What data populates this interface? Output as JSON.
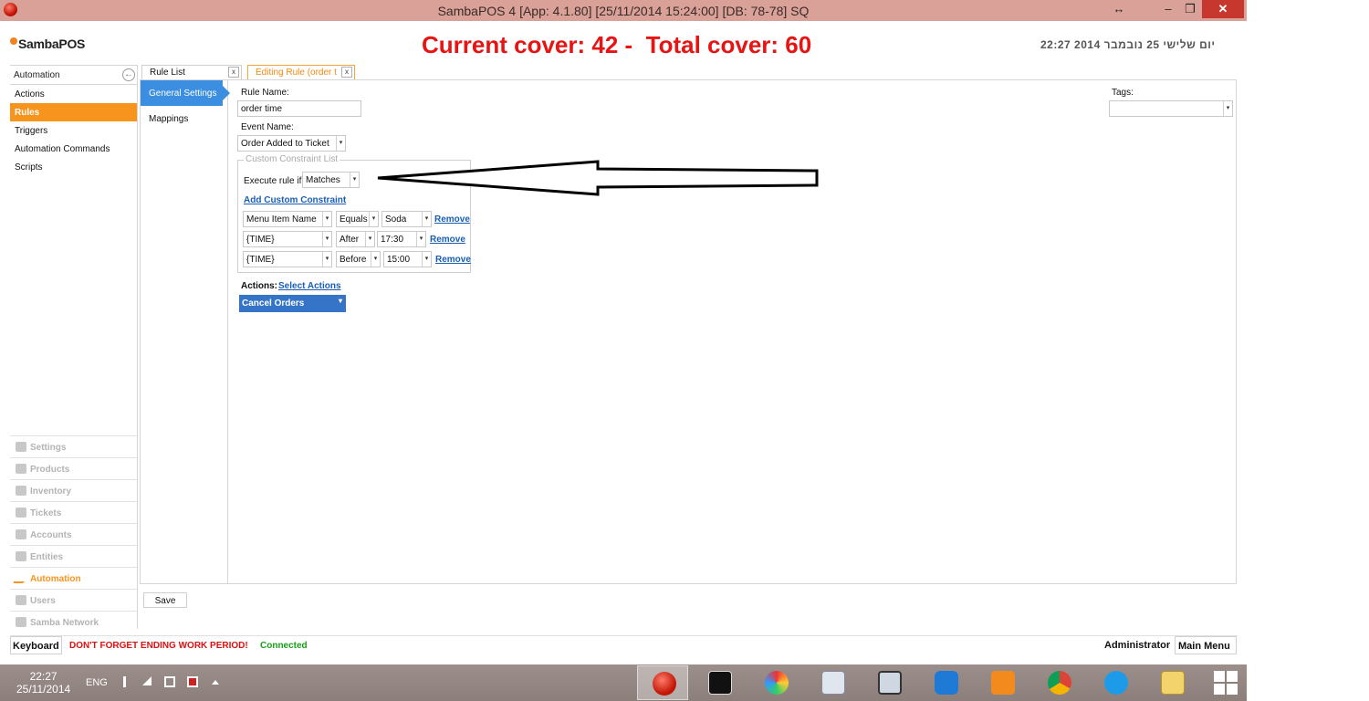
{
  "window": {
    "title": "SambaPOS 4 [App: 4.1.80] [25/11/2014 15:24:00] [DB: 78-78] SQ",
    "resize_glyph": "↔",
    "min_glyph": "–",
    "max_glyph": "❐",
    "close_glyph": "✕"
  },
  "header": {
    "logo": "SambaPOS",
    "cover_text": "Current cover: 42 -  Total cover: 60",
    "datetime": "יום שלישי 25 נובמבר 2014 22:27"
  },
  "leftnav": {
    "title": "Automation",
    "back_glyph": "←",
    "items": [
      {
        "label": "Actions",
        "active": false
      },
      {
        "label": "Rules",
        "active": true
      },
      {
        "label": "Triggers",
        "active": false
      },
      {
        "label": "Automation Commands",
        "active": false
      },
      {
        "label": "Scripts",
        "active": false
      }
    ],
    "sections": [
      {
        "label": "Settings",
        "icon": "gear-icon",
        "active": false
      },
      {
        "label": "Products",
        "icon": "cup-icon",
        "active": false
      },
      {
        "label": "Inventory",
        "icon": "inventory-icon",
        "active": false
      },
      {
        "label": "Tickets",
        "icon": "tickets-icon",
        "active": false
      },
      {
        "label": "Accounts",
        "icon": "calculator-icon",
        "active": false
      },
      {
        "label": "Entities",
        "icon": "entities-icon",
        "active": false
      },
      {
        "label": "Automation",
        "icon": "pencil-icon",
        "active": true
      },
      {
        "label": "Users",
        "icon": "user-icon",
        "active": false
      },
      {
        "label": "Samba Network",
        "icon": "globe-icon",
        "active": false
      }
    ]
  },
  "tabs": [
    {
      "label": "Rule List",
      "close": "x"
    },
    {
      "label": "Editing Rule (order t",
      "close": "x"
    }
  ],
  "subnav": [
    {
      "label": "General Settings",
      "active": true
    },
    {
      "label": "Mappings",
      "active": false
    }
  ],
  "form": {
    "rule_name_label": "Rule Name:",
    "rule_name_value": "order time",
    "event_name_label": "Event Name:",
    "event_name_value": "Order Added to Ticket",
    "tags_label": "Tags:",
    "tags_value": "",
    "constraint_legend": "Custom Constraint List",
    "execute_label": "Execute rule if",
    "execute_value": "Matches",
    "add_constraint_link": "Add Custom Constraint",
    "constraints": [
      {
        "name": "Menu Item Name",
        "op": "Equals",
        "value": "Soda",
        "remove": "Remove"
      },
      {
        "name": "{TIME}",
        "op": "After",
        "value": "17:30",
        "remove": "Remove"
      },
      {
        "name": "{TIME}",
        "op": "Before",
        "value": "15:00",
        "remove": "Remove"
      }
    ],
    "actions_label": "Actions:",
    "select_actions_link": "Select Actions",
    "actions_value": "Cancel Orders",
    "dropdown_glyph": "▾"
  },
  "save_label": "Save",
  "statusbar": {
    "keyboard": "Keyboard",
    "warning": "DON'T FORGET ENDING WORK PERIOD!",
    "connected": "Connected",
    "user": "Administrator",
    "main_menu": "Main Menu"
  },
  "taskbar": {
    "time": "22:27",
    "date": "25/11/2014",
    "lang": "ENG"
  },
  "colors": {
    "accent_orange": "#f7941d",
    "cover_red": "#e81414",
    "selection_blue": "#3c8ee0",
    "action_blue": "#3574c7",
    "connected_green": "#19a019"
  }
}
